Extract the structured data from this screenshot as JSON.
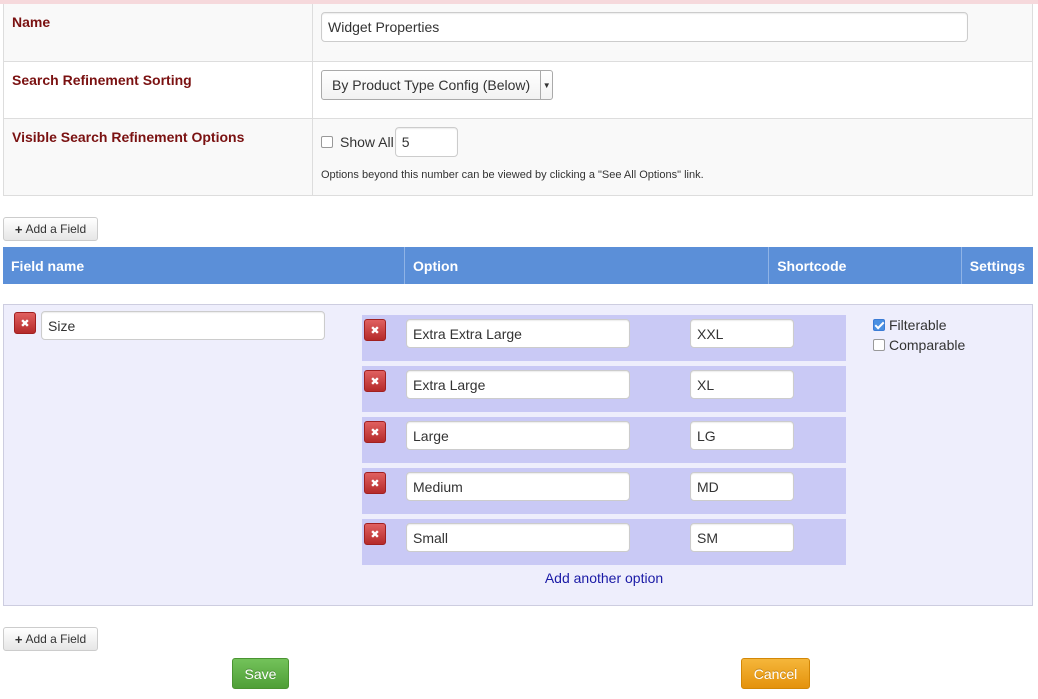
{
  "properties": {
    "name_label": "Name",
    "name_value": "Widget Properties",
    "sorting_label": "Search Refinement Sorting",
    "sorting_value": "By Product Type Config (Below)",
    "visible_label": "Visible Search Refinement Options",
    "show_all_label": "Show All",
    "show_all_checked": false,
    "visible_count": "5",
    "help_text": "Options beyond this number can be viewed by clicking a \"See All Options\" link."
  },
  "add_field_label": "Add a Field",
  "fields_header": {
    "field_name": "Field name",
    "option": "Option",
    "shortcode": "Shortcode",
    "settings": "Settings"
  },
  "field": {
    "name": "Size",
    "options": [
      {
        "label": "Extra Extra Large",
        "code": "XXL"
      },
      {
        "label": "Extra Large",
        "code": "XL"
      },
      {
        "label": "Large",
        "code": "LG"
      },
      {
        "label": "Medium",
        "code": "MD"
      },
      {
        "label": "Small",
        "code": "SM"
      }
    ],
    "add_option_label": "Add another option",
    "filterable_label": "Filterable",
    "filterable_checked": true,
    "comparable_label": "Comparable",
    "comparable_checked": false
  },
  "delete_glyph": "✖",
  "actions": {
    "save_label": "Save",
    "cancel_label": "Cancel"
  },
  "colors": {
    "header_bar": "#5b8fd8",
    "label_text": "#7a1111",
    "save": "#5fb045",
    "cancel": "#f0a323",
    "link": "#1a1aa6"
  }
}
